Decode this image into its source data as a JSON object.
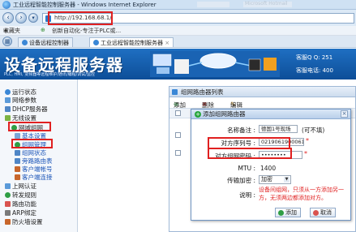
{
  "window": {
    "title": "工业远程智能控制服务器 - Windows Internet Explorer",
    "blurred_1": "",
    "blurred_2": "Microsoft Hotmail"
  },
  "nav": {
    "url": "http://192.168.68.1/"
  },
  "favorites": {
    "label": "收藏夹",
    "item1": "创新自动化-专注于PLC或..."
  },
  "tabs": [
    {
      "label": "设备远程控制器"
    },
    {
      "label": "工业远程智能控制服务器"
    }
  ],
  "banner": {
    "title": "设备远程服务器",
    "subtitle": "PLC, HMI, 变频器等远程维护/通讯/编程/调试/监控",
    "qq": "客服Q Q: 251",
    "phone": "客服电话: 400"
  },
  "sidebar": {
    "items": [
      {
        "label": "运行状态"
      },
      {
        "label": "网络参数"
      },
      {
        "label": "DHCP服务器"
      },
      {
        "label": "无线设置"
      },
      {
        "label": "网域组网"
      },
      {
        "label": "基本设置"
      },
      {
        "label": "组网管理"
      },
      {
        "label": "组网状态"
      },
      {
        "label": "旁路路由表"
      },
      {
        "label": "客户端帐号"
      },
      {
        "label": "客户端连接"
      },
      {
        "label": "上网认证"
      },
      {
        "label": "转发规则"
      },
      {
        "label": "路由功能"
      },
      {
        "label": "ARP绑定"
      },
      {
        "label": "防火墙设置"
      }
    ]
  },
  "panel": {
    "title": "组网路由器列表",
    "add_label": "添加",
    "delete_label": "删除",
    "edit_label": "编辑"
  },
  "dialog": {
    "title": "添加组网路由器",
    "name_label": "名称备注 :",
    "name_value": "德国1号现场",
    "name_note": "(可不填)",
    "serial_label": "对方序列号 :",
    "serial_value": "021906190006102",
    "password_label": "对方组网密码 :",
    "password_value": "••••••••",
    "mtu_label": "MTU :",
    "mtu_value": "1400",
    "encrypt_label": "传输加密 :",
    "encrypt_value": "加密",
    "explain_label": "说明 :",
    "explain_text": "设备间组网，只须从一方添加另一方，无须两边都添加对方。",
    "confirm_label": "添加",
    "cancel_label": "取消"
  }
}
